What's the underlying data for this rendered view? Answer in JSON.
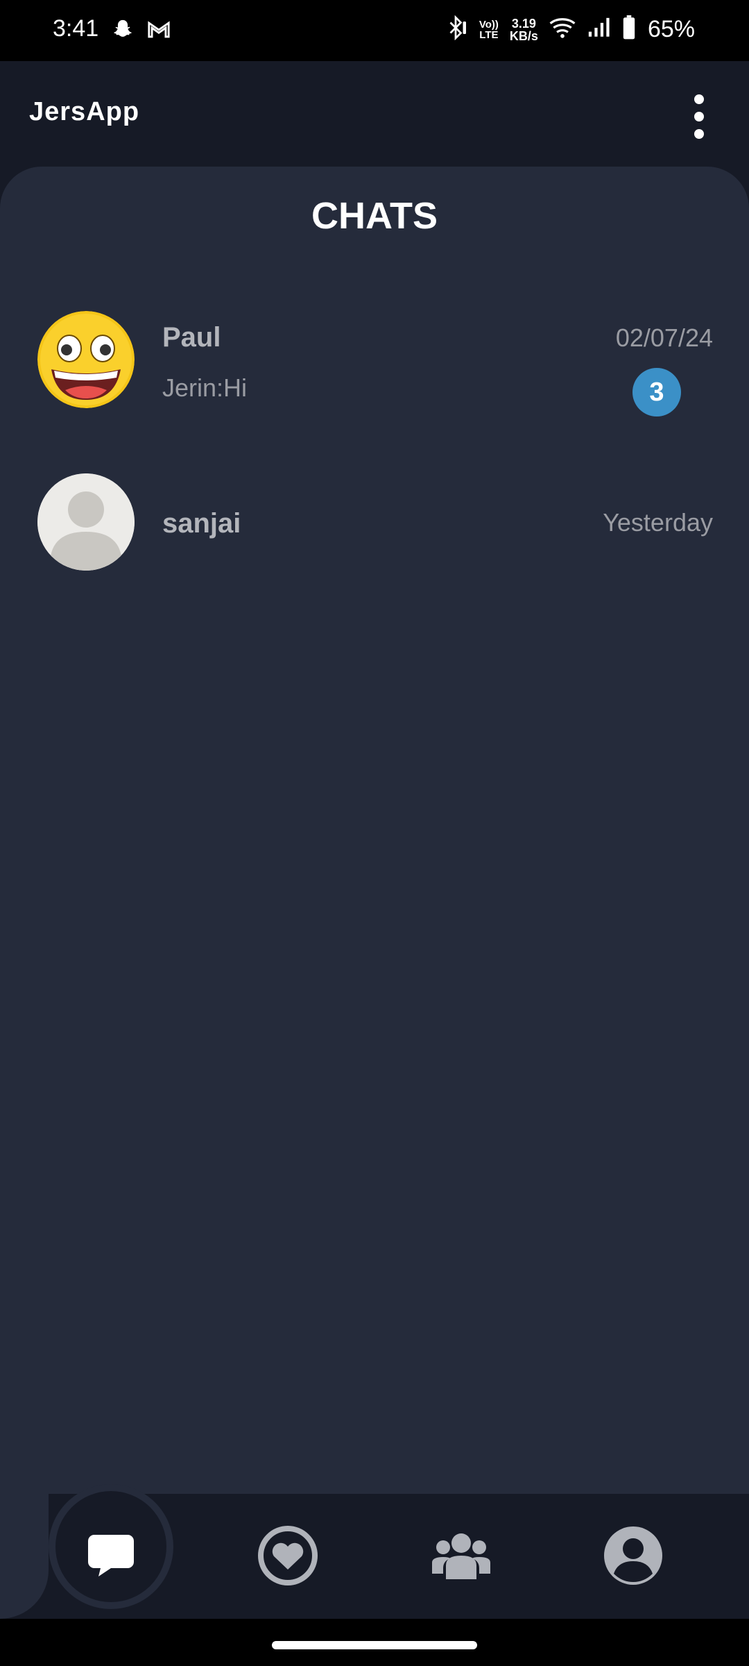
{
  "status_bar": {
    "time": "3:41",
    "network_speed_value": "3.19",
    "network_speed_unit": "KB/s",
    "volte_line1": "Vo))",
    "volte_line2": "LTE",
    "battery_percent": "65%",
    "icons": [
      "snapchat-icon",
      "gmail-icon",
      "bluetooth-icon",
      "volte-icon",
      "wifi-icon",
      "signal-icon",
      "battery-icon"
    ]
  },
  "app_bar": {
    "title": "JersApp",
    "menu_icon": "more-vert-icon"
  },
  "main": {
    "section_title": "CHATS",
    "chats": [
      {
        "name": "Paul",
        "last_message": "Jerin:Hi",
        "time": "02/07/24",
        "unread_count": "3",
        "avatar": "grinning-emoji-avatar"
      },
      {
        "name": "sanjai",
        "time": "Yesterday",
        "avatar": "default-person-avatar"
      }
    ]
  },
  "bottom_nav": {
    "items": [
      {
        "icon": "chat-bubble-icon",
        "active": true
      },
      {
        "icon": "heart-icon",
        "active": false
      },
      {
        "icon": "group-icon",
        "active": false
      },
      {
        "icon": "profile-icon",
        "active": false
      }
    ]
  },
  "colors": {
    "app_bar_bg": "#161a26",
    "content_bg": "#252b3b",
    "badge": "#3b90c7",
    "nav_icon": "#b0b3ba"
  }
}
